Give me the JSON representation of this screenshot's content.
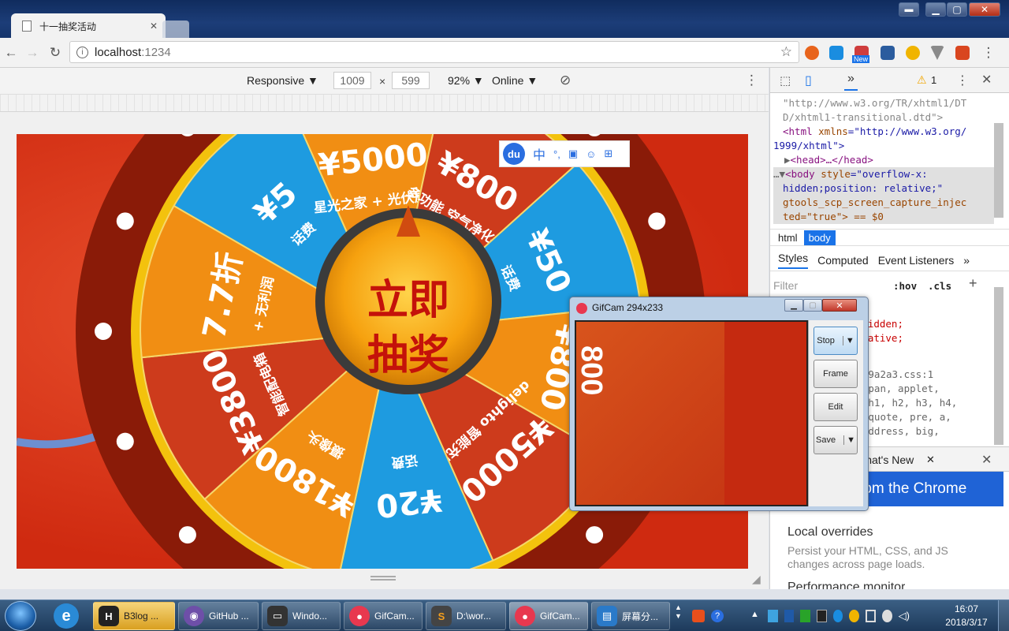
{
  "browser": {
    "tab_title": "十一抽奖活动",
    "url_host": "localhost",
    "url_port": ":1234",
    "new_badge": "New"
  },
  "device_toolbar": {
    "mode": "Responsive ▼",
    "width": "1009",
    "times": "×",
    "height": "599",
    "zoom": "92% ▼",
    "network": "Online ▼"
  },
  "wheel": {
    "center_line1": "立即",
    "center_line2": "抽奖",
    "prizes": [
      {
        "amount": "¥5",
        "desc": "话费"
      },
      {
        "amount": "¥5000",
        "desc": "星光之家 + 光伏屋顶"
      },
      {
        "amount": "¥800",
        "desc": "多功能 空气净化器"
      },
      {
        "amount": "¥50",
        "desc": "话费"
      },
      {
        "amount": "¥800",
        "desc": ""
      },
      {
        "amount": "¥5000",
        "desc": "delighto 智能充电桩"
      },
      {
        "amount": "¥20",
        "desc": "话费"
      },
      {
        "amount": "¥1800",
        "desc": "摄像头"
      },
      {
        "amount": "¥3800",
        "desc": "智能配电箱"
      },
      {
        "amount": "7.7折",
        "desc": "+ 无利润"
      }
    ],
    "du_toolbar": "du"
  },
  "devtools": {
    "warning_count": "1",
    "dom_lines": {
      "l1": "\"http://www.w3.org/TR/xhtml1/DT",
      "l2": "D/xhtml1-transitional.dtd\">",
      "l3a": "<html ",
      "l3b": "xmlns",
      "l3c": "=\"http://www.w3.org/",
      "l4": "1999/xhtml\">",
      "l5": "<head>…</head>",
      "l6a": "<body ",
      "l6b": "style",
      "l6c": "=\"overflow-x:",
      "l7": "hidden;position: relative;\"",
      "l8": "gtools_scp_screen_capture_injec",
      "l9": "ted=\"true\"> == $0"
    },
    "breadcrumb": [
      "html",
      "body"
    ],
    "subtabs": [
      "Styles",
      "Computed",
      "Event Listeners"
    ],
    "filter_placeholder": "Filter",
    "hov": ":hov",
    "cls": ".cls",
    "style_lines": [
      "overflow-x: hidden;",
      "position: relative;",
      "}"
    ],
    "source_line": "ht d44...5cd…4fc9a2a3.css:1",
    "selector_lines": [
      "ml, body, div, span, applet,",
      "object, iframe, h1, h2, h3, h4,",
      "h5, h6, p, blockquote, pre, a,",
      "abbr, acronym, address, big,"
    ],
    "drawer_tab": "What's New",
    "banner": "Highlights from the Chrome",
    "section_title": "Local overrides",
    "section_desc": "Persist your HTML, CSS, and JS changes across page loads.",
    "section_cut": "Performance monitor"
  },
  "gifcam": {
    "title": "GifCam 294x233",
    "buttons": [
      "Stop",
      "Frame",
      "Edit",
      "Save"
    ],
    "preview_text": "800"
  },
  "taskbar": {
    "items": [
      "B3log ...",
      "GitHub ...",
      "Windo...",
      "GifCam...",
      "D:\\wor...",
      "GifCam...",
      "屏幕分..."
    ],
    "time": "16:07",
    "date": "2018/3/17"
  }
}
